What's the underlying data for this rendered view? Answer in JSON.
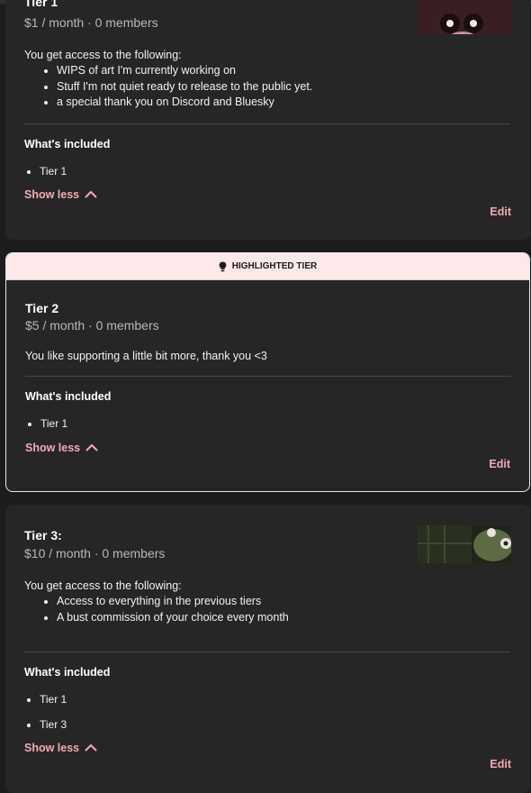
{
  "tiers": [
    {
      "name": "Tier 1",
      "price": "$1 / month · 0 members",
      "desc_intro": "You get access to the following:",
      "benefits": [
        "WIPS of art I'm currently working on",
        "Stuff I'm not quiet ready to release to the public yet.",
        "a special thank you on Discord and Bluesky"
      ],
      "included_title": "What's included",
      "included": [
        "Tier 1"
      ],
      "show_less": "Show less",
      "edit": "Edit"
    },
    {
      "banner": "HIGHLIGHTED TIER",
      "name": "Tier 2",
      "price": "$5 / month · 0 members",
      "desc": "You like supporting a little bit more, thank you <3",
      "included_title": "What's included",
      "included": [
        "Tier 1"
      ],
      "show_less": "Show less",
      "edit": "Edit"
    },
    {
      "name": "Tier 3:",
      "price": "$10 / month · 0 members",
      "desc_intro": "You get access to the following:",
      "benefits": [
        "Access to everything in the previous tiers",
        "A bust commission of your choice every month"
      ],
      "included_title": "What's included",
      "included": [
        "Tier 1",
        "Tier 3"
      ],
      "show_less": "Show less",
      "edit": "Edit"
    }
  ],
  "colors": {
    "accent": "#f5a9b6",
    "card_bg": "#262626",
    "page_bg": "#1c1c1c",
    "banner_bg": "#fde8ea"
  }
}
